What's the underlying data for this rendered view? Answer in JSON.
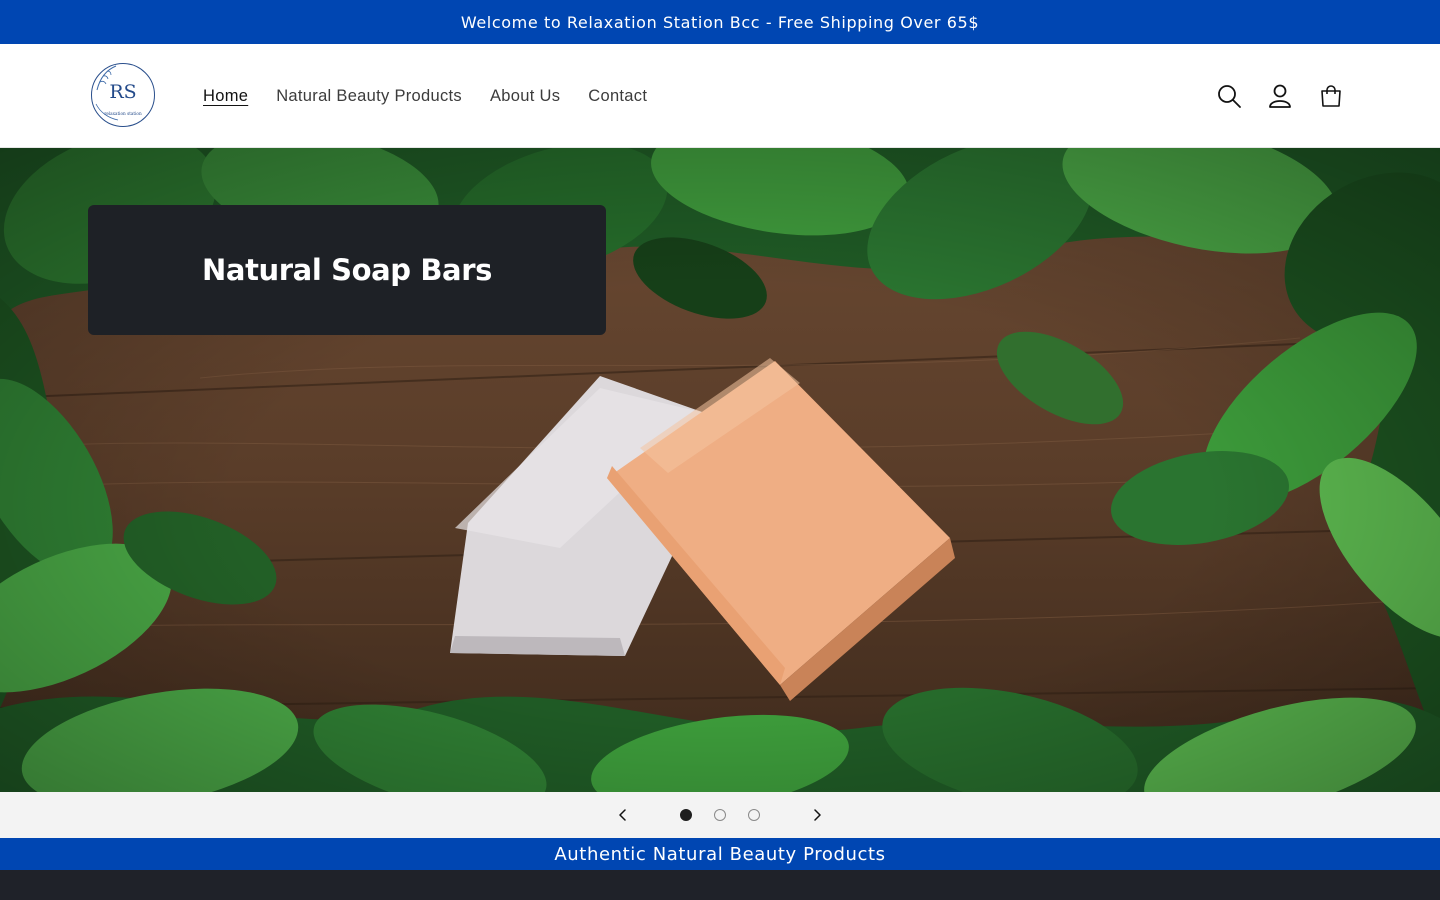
{
  "announcement": {
    "text": "Welcome to Relaxation Station Bcc - Free Shipping Over 65$"
  },
  "header": {
    "logo_letters": "RS",
    "logo_caption": "relaxation station",
    "nav": [
      {
        "label": "Home",
        "active": true
      },
      {
        "label": "Natural Beauty Products",
        "active": false
      },
      {
        "label": "About Us",
        "active": false
      },
      {
        "label": "Contact",
        "active": false
      }
    ],
    "icons": [
      "search-icon",
      "account-icon",
      "cart-icon"
    ]
  },
  "hero": {
    "slide_title": "Natural Soap Bars",
    "slides_count": 3,
    "active_slide": 1
  },
  "band": {
    "text": "Authentic Natural Beauty Products"
  },
  "colors": {
    "brand_blue": "#0046b2",
    "dark": "#1e2126",
    "controls_bg": "#f3f3f3"
  }
}
